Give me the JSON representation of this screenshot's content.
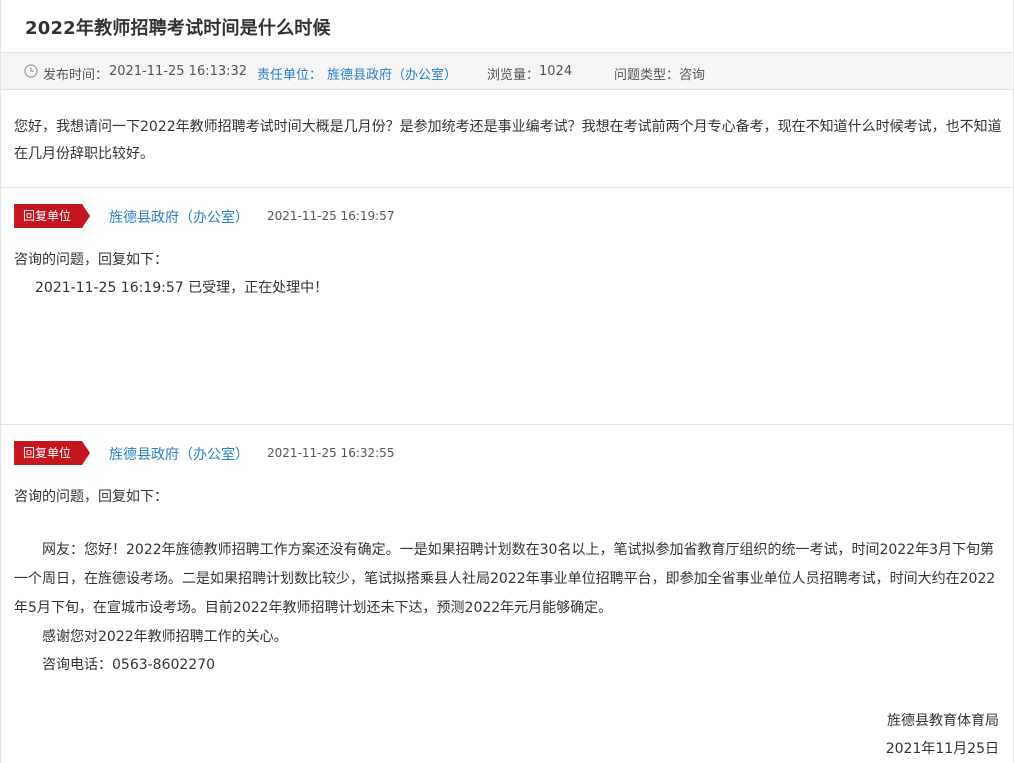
{
  "title": "2022年教师招聘考试时间是什么时候",
  "meta": {
    "publish_label": "发布时间：",
    "publish_time": "2021-11-25 16:13:32",
    "unit_label": "责任单位：",
    "unit_name": "旌德县政府（办公室）",
    "views_label": "浏览量：",
    "views_count": "1024",
    "type_label": "问题类型：",
    "type_value": "咨询"
  },
  "question": "您好，我想请问一下2022年教师招聘考试时间大概是几月份？是参加统考还是事业编考试？我想在考试前两个月专心备考，现在不知道什么时候考试，也不知道在几月份辞职比较好。",
  "replies": [
    {
      "tag": "回复单位",
      "unit": "旌德县政府（办公室）",
      "time": "2021-11-25 16:19:57",
      "intro": "咨询的问题，回复如下：",
      "line1": "2021-11-25 16:19:57 已受理，正在处理中！"
    },
    {
      "tag": "回复单位",
      "unit": "旌德县政府（办公室）",
      "time": "2021-11-25 16:32:55",
      "intro": "咨询的问题，回复如下：",
      "body": "网友：您好！2022年旌德教师招聘工作方案还没有确定。一是如果招聘计划数在30名以上，笔试拟参加省教育厅组织的统一考试，时间2022年3月下旬第一个周日，在旌德设考场。二是如果招聘计划数比较少，笔试拟搭乘县人社局2022年事业单位招聘平台，即参加全省事业单位人员招聘考试，时间大约在2022年5月下旬，在宣城市设考场。目前2022年教师招聘计划还未下达，预测2022年元月能够确定。",
      "thanks": "感谢您对2022年教师招聘工作的关心。",
      "phone": "咨询电话：0563-8602270",
      "signature": "旌德县教育体育局",
      "date": "2021年11月25日"
    }
  ],
  "colors": {
    "accent": "#c4161c",
    "link": "#2a7fc9"
  },
  "icons": {
    "publish": "clock-icon"
  }
}
